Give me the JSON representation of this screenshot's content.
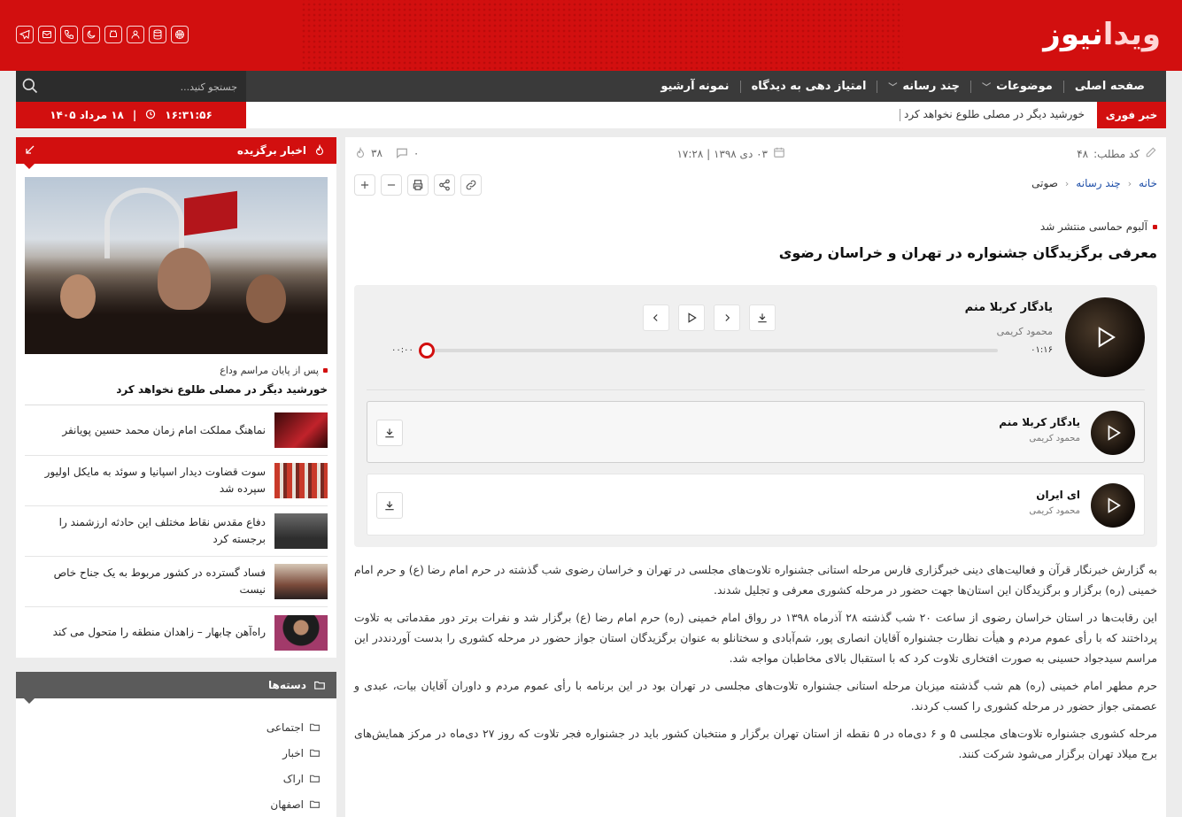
{
  "header": {
    "logo_primary": "ویدا",
    "logo_secondary": "نیوز",
    "social_icons": [
      "telegram-icon",
      "mail-icon",
      "phone-icon",
      "moon-icon",
      "android-icon",
      "user-icon",
      "database-icon",
      "basketball-icon"
    ]
  },
  "nav": {
    "items": [
      {
        "label": "صفحه اصلی",
        "has_dropdown": false
      },
      {
        "label": "موضوعات",
        "has_dropdown": true
      },
      {
        "label": "چند رسانه",
        "has_dropdown": true
      },
      {
        "label": "امتیاز دهی به دیدگاه",
        "has_dropdown": false
      },
      {
        "label": "نمونه آرشیو",
        "has_dropdown": false
      }
    ],
    "search_placeholder": "جستجو کنید..."
  },
  "breaking": {
    "label": "خبر فوری",
    "ticker": "خورشید دیگر در مصلی طلوع نخواهد کرد",
    "time": "۱۶:۳۱:۵۶",
    "date": "۱۸ مرداد ۱۴۰۵"
  },
  "article": {
    "code_label": "کد مطلب:",
    "code_value": "۴۸",
    "date": "۰۳ دی ۱۳۹۸ | ۱۷:۲۸",
    "views": "۳۸",
    "comments": "۰",
    "breadcrumb": [
      "خانه",
      "چند رسانه",
      "صوتی"
    ],
    "subtitle": "آلبوم حماسی منتشر شد",
    "title": "معرفی برگزیدگان جشنواره در تهران و خراسان رضوی",
    "paragraphs": [
      "به گزارش خبرنگار قرآن و فعالیت‌های دینی خبرگزاری فارس مرحله استانی جشنواره تلاوت‌های مجلسی در تهران و خراسان رضوی شب گذشته در حرم امام رضا (ع) و حرم امام خمینی (ره) برگزار و برگزیدگان این استان‌ها جهت حضور در مرحله کشوری معرفی و تجلیل شدند.",
      "این رقابت‌ها در استان خراسان رضوی از ساعت ۲۰ شب گذشته ۲۸ آذرماه ۱۳۹۸ در رواق امام خمینی (ره) حرم امام رضا (ع) برگزار شد و نفرات برتر دور مقدماتی به تلاوت پرداختند که با رأی عموم مردم و هیأت نظارت جشنواره آقایان انصاری پور، شم‌آبادی و سختانلو به عنوان برگزیدگان استان جواز حضور در مرحله کشوری را بدست آوردند‌در این مراسم سیدجواد حسینی به صورت افتخاری تلاوت کرد که با استقبال بالای مخاطبان مواجه شد.",
      "حرم مطهر امام خمینی (ره) هم شب گذشته میزبان مرحله استانی جشنواره تلاوت‌های مجلسی در تهران بود در این برنامه با رأی عموم مردم و داوران آقایان بیات، عبدی و عصمتی جواز حضور در مرحله کشوری را کسب کردند.",
      "مرحله کشوری جشنواره تلاوت‌های مجلسی ۵ و ۶ دی‌ماه در ۵ نقطه از استان تهران برگزار و منتخبان کشور باید در جشنواره فجر تلاوت که روز ۲۷ دی‌ماه در مرکز همایش‌های برج میلاد تهران برگزار می‌شود شرکت کنند."
    ]
  },
  "player": {
    "now_title": "یادگار کربلا منم",
    "now_artist": "محمود کریمی",
    "duration": "۰۱:۱۶",
    "current": "۰۰:۰۰",
    "progress": 0,
    "playlist": [
      {
        "title": "یادگار کربلا منم",
        "artist": "محمود کریمی"
      },
      {
        "title": "ای ایران",
        "artist": "محمود کریمی"
      }
    ]
  },
  "sidebar": {
    "featured_title": "اخبار برگزیده",
    "lead_sub": "پس از پایان مراسم وداع",
    "lead_title": "خورشید دیگر در مصلی طلوع نخواهد کرد",
    "news": [
      {
        "title": "نماهنگ مملکت امام زمان محمد حسین پویانفر"
      },
      {
        "title": "سوت قضاوت دیدار اسپانیا و سوئد به مایکل اولیور سپرده شد"
      },
      {
        "title": "دفاع مقدس نقاط مختلف این حادثه ارزشمند را برجسته کرد"
      },
      {
        "title": "فساد گسترده در کشور مربوط به یک جناح خاص نیست"
      },
      {
        "title": "راه‌آهن چابهار – زاهدان منطقه را متحول می کند"
      }
    ],
    "categories_title": "دسته‌ها",
    "categories": [
      "اجتماعی",
      "اخبار",
      "اراک",
      "اصفهان"
    ]
  },
  "colors": {
    "brand": "#d20f0f",
    "dark": "#3a3a3a"
  }
}
